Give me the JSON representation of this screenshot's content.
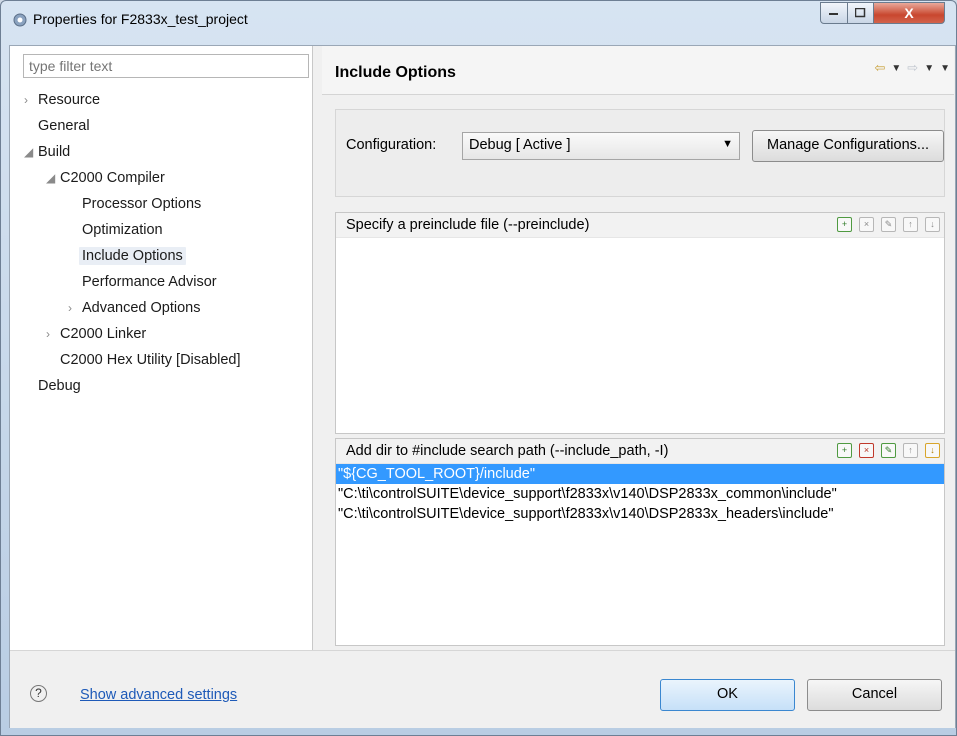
{
  "window": {
    "title": "Properties for F2833x_test_project",
    "close_label": "X"
  },
  "filter": {
    "placeholder": "type filter text"
  },
  "tree": {
    "items": [
      {
        "label": "Resource",
        "arrow": "›"
      },
      {
        "label": "General",
        "arrow": ""
      },
      {
        "label": "Build",
        "arrow": "◢"
      },
      {
        "label": "C2000 Compiler",
        "arrow": "◢"
      },
      {
        "label": "Processor Options",
        "arrow": ""
      },
      {
        "label": "Optimization",
        "arrow": ""
      },
      {
        "label": "Include Options",
        "arrow": ""
      },
      {
        "label": "Performance Advisor",
        "arrow": ""
      },
      {
        "label": "Advanced Options",
        "arrow": "›"
      },
      {
        "label": "C2000 Linker",
        "arrow": "›"
      },
      {
        "label": "C2000 Hex Utility  [Disabled]",
        "arrow": ""
      },
      {
        "label": "Debug",
        "arrow": ""
      }
    ]
  },
  "page": {
    "title": "Include Options",
    "configuration_label": "Configuration:",
    "configuration_value": "Debug  [ Active ]",
    "manage_button": "Manage Configurations..."
  },
  "preinclude": {
    "caption": "Specify a preinclude file (--preinclude)"
  },
  "include_path": {
    "caption": "Add dir to #include search path (--include_path, -I)",
    "rows": [
      "\"${CG_TOOL_ROOT}/include\"",
      "\"C:\\ti\\controlSUITE\\device_support\\f2833x\\v140\\DSP2833x_common\\include\"",
      "\"C:\\ti\\controlSUITE\\device_support\\f2833x\\v140\\DSP2833x_headers\\include\""
    ]
  },
  "footer": {
    "help_symbol": "?",
    "advanced_link": "Show advanced settings",
    "ok": "OK",
    "cancel": "Cancel"
  },
  "icons": [
    "app-icon",
    "back-icon",
    "forward-icon",
    "add-icon",
    "delete-icon",
    "edit-icon",
    "move-up-icon",
    "move-down-icon",
    "help-icon"
  ]
}
